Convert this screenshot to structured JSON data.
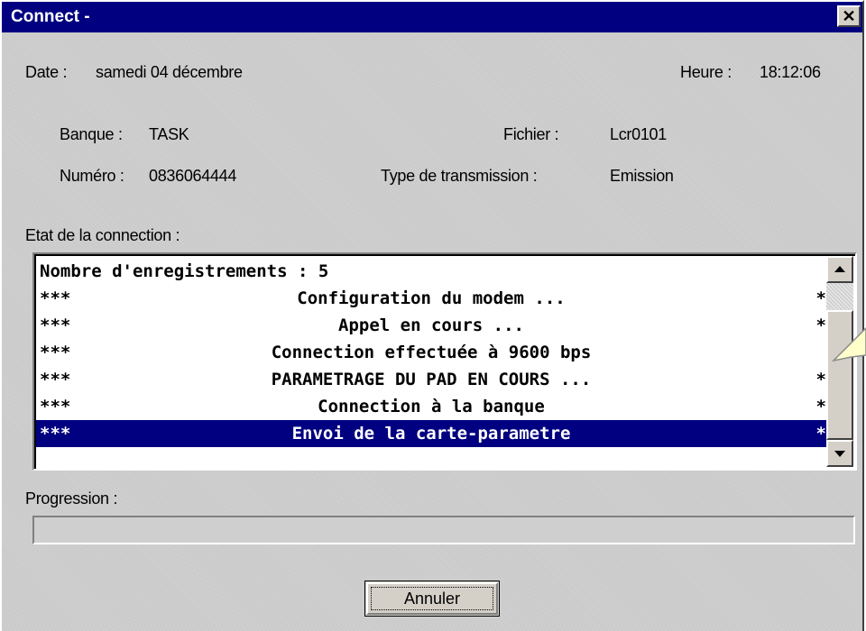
{
  "window": {
    "title": "Connect -",
    "close_symbol": "✕"
  },
  "info": {
    "date_label": "Date :",
    "date_value": "samedi 04 décembre",
    "time_label": "Heure :",
    "time_value": "18:12:06",
    "bank_label": "Banque :",
    "bank_value": "TASK",
    "file_label": "Fichier :",
    "file_value": "Lcr0101",
    "number_label": "Numéro :",
    "number_value": "0836064444",
    "transmission_label": "Type de transmission :",
    "transmission_value": "Emission"
  },
  "connection": {
    "label": "Etat de la connection :",
    "first_line": "Nombre d'enregistrements : 5",
    "lines": [
      {
        "prefix": "***",
        "text": "Configuration du modem ...",
        "suffix": "*"
      },
      {
        "prefix": "***",
        "text": "Appel en cours ...",
        "suffix": "*"
      },
      {
        "prefix": "***",
        "text": "Connection effectuée à 9600 bps",
        "suffix": ""
      },
      {
        "prefix": "***",
        "text": "PARAMETRAGE DU PAD EN COURS ...",
        "suffix": "*"
      },
      {
        "prefix": "***",
        "text": "Connection à la banque",
        "suffix": "*"
      },
      {
        "prefix": "***",
        "text": "Envoi de la carte-parametre",
        "suffix": "*"
      }
    ],
    "selected_line": "Envoi de la carte-parametre"
  },
  "progress": {
    "label": "Progression :",
    "value": 0
  },
  "buttons": {
    "cancel": "Annuler"
  },
  "colors": {
    "title_bar": "#000080",
    "selection": "#000080",
    "tooltip": "#ffffcc"
  }
}
